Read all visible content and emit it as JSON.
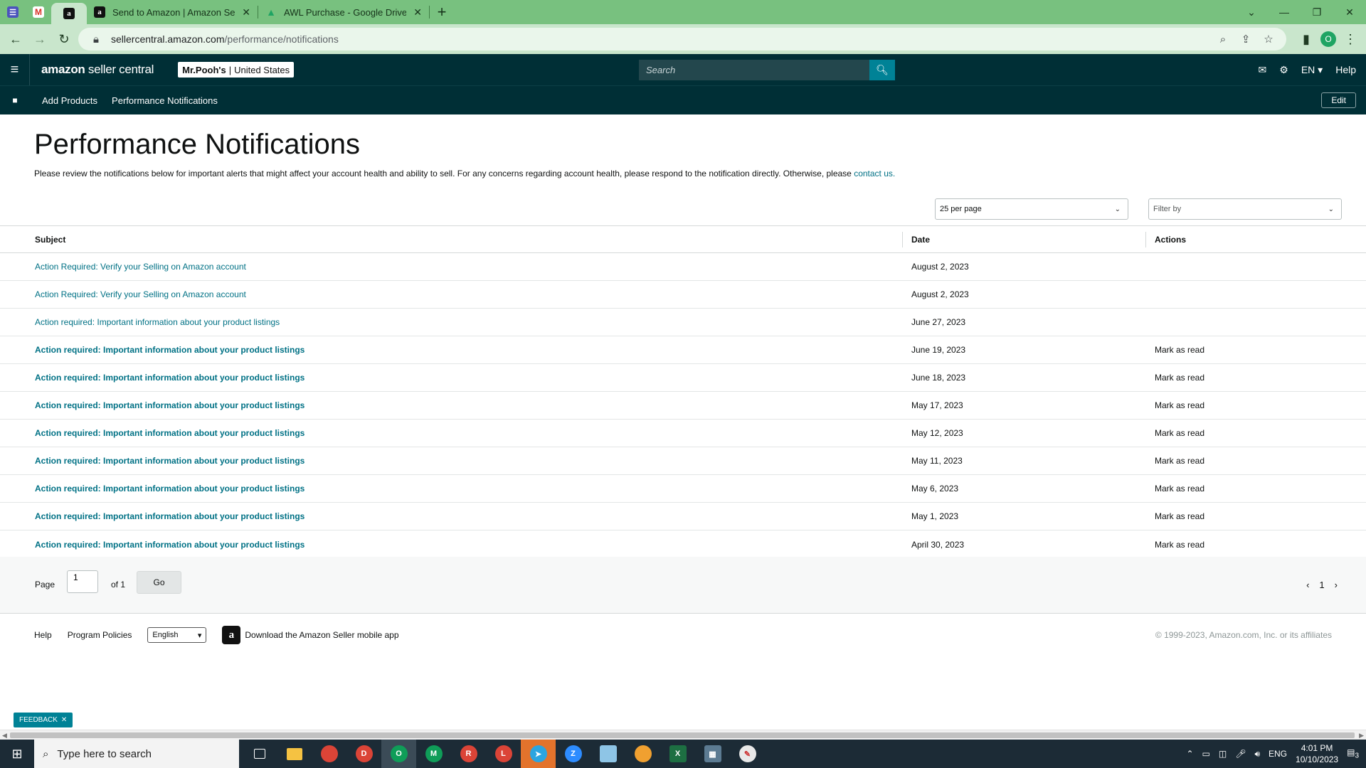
{
  "browser": {
    "tabs": [
      {
        "title": "Send to Amazon | Amazon Seller Central"
      },
      {
        "title": "AWL Purchase - Google Drive"
      }
    ],
    "url_host": "sellercentral.amazon.com",
    "url_path": "/performance/notifications",
    "profile_initial": "O"
  },
  "header": {
    "brand_bold": "amazon",
    "brand_light": " seller central",
    "store_name": "Mr.Pooh's",
    "store_region": "United States",
    "search_placeholder": "Search",
    "language": "EN",
    "help": "Help"
  },
  "bookmarks": {
    "items": [
      "Add Products",
      "Performance Notifications"
    ],
    "edit": "Edit"
  },
  "page": {
    "title": "Performance Notifications",
    "intro": "Please review the notifications below for important alerts that might affect your account health and ability to sell. For any concerns regarding account health, please respond to the notification directly. Otherwise, please ",
    "intro_link": "contact us.",
    "per_page": "25 per page",
    "filter": "Filter by"
  },
  "table": {
    "headers": {
      "subject": "Subject",
      "date": "Date",
      "actions": "Actions"
    },
    "rows": [
      {
        "subject": "Action Required: Verify your Selling on Amazon account",
        "date": "August 2, 2023",
        "action": "",
        "unread": false
      },
      {
        "subject": "Action Required: Verify your Selling on Amazon account",
        "date": "August 2, 2023",
        "action": "",
        "unread": false
      },
      {
        "subject": "Action required: Important information about your product listings",
        "date": "June 27, 2023",
        "action": "",
        "unread": false
      },
      {
        "subject": "Action required: Important information about your product listings",
        "date": "June 19, 2023",
        "action": "Mark as read",
        "unread": true
      },
      {
        "subject": "Action required: Important information about your product listings",
        "date": "June 18, 2023",
        "action": "Mark as read",
        "unread": true
      },
      {
        "subject": "Action required: Important information about your product listings",
        "date": "May 17, 2023",
        "action": "Mark as read",
        "unread": true
      },
      {
        "subject": "Action required: Important information about your product listings",
        "date": "May 12, 2023",
        "action": "Mark as read",
        "unread": true
      },
      {
        "subject": "Action required: Important information about your product listings",
        "date": "May 11, 2023",
        "action": "Mark as read",
        "unread": true
      },
      {
        "subject": "Action required: Important information about your product listings",
        "date": "May 6, 2023",
        "action": "Mark as read",
        "unread": true
      },
      {
        "subject": "Action required: Important information about your product listings",
        "date": "May 1, 2023",
        "action": "Mark as read",
        "unread": true
      },
      {
        "subject": "Action required: Important information about your product listings",
        "date": "April 30, 2023",
        "action": "Mark as read",
        "unread": true
      }
    ]
  },
  "pager": {
    "page_label": "Page",
    "page_value": "1",
    "of_label": "of 1",
    "go": "Go",
    "current": "1"
  },
  "footer": {
    "help": "Help",
    "policies": "Program Policies",
    "language": "English",
    "app_text": "Download the Amazon Seller mobile app",
    "copyright": "© 1999-2023, Amazon.com, Inc. or its affiliates"
  },
  "feedback": "FEEDBACK",
  "taskbar": {
    "search_placeholder": "Type here to search",
    "lang": "ENG",
    "time": "4:01 PM",
    "date": "10/10/2023",
    "notif_count": "3"
  },
  "colors": {
    "header_bg": "#002f36",
    "link": "#007185",
    "accent": "#008296",
    "browser_frame": "#78c17f"
  }
}
